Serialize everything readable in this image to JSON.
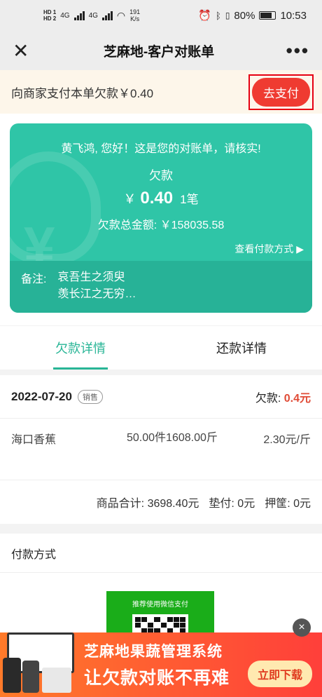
{
  "status_bar": {
    "hd1": "HD 1",
    "hd2": "HD 2",
    "net1": "4G",
    "net2": "4G",
    "speed_value": "191",
    "speed_unit": "K/s",
    "battery_percent": "80%",
    "battery_level": 0.8,
    "time": "10:53"
  },
  "nav": {
    "title": "芝麻地-客户对账单",
    "close_icon": "close-icon",
    "more_icon": "more-icon"
  },
  "pay_bar": {
    "text": "向商家支付本单欠款￥0.40",
    "button": "去支付"
  },
  "card": {
    "greeting": "黄飞鸿, 您好！这是您的对账单，请核实!",
    "debt_label": "欠款",
    "currency": "￥",
    "debt_value": "0.40",
    "debt_count": "1笔",
    "total_label": "欠款总金额: ￥158035.58",
    "payment_link": "查看付款方式",
    "remark_label": "备注:",
    "remark_line1": "哀吾生之须臾",
    "remark_line2": "羡长江之无穷…"
  },
  "tabs": [
    {
      "label": "欠款详情",
      "active": true
    },
    {
      "label": "还款详情",
      "active": false
    }
  ],
  "order": {
    "date": "2022-07-20",
    "tag": "销售",
    "debt_label": "欠款:",
    "debt_value": "0.4元",
    "items": [
      {
        "name": "海口香蕉",
        "qty": "50.00件1608.00斤",
        "price": "2.30元/斤"
      }
    ],
    "summary": {
      "goods_total": "商品合计: 3698.40元",
      "advance": "垫付: 0元",
      "deposit": "押筐: 0元"
    }
  },
  "payment": {
    "title": "付款方式",
    "qr_caption": "推荐使用微信支付"
  },
  "ad": {
    "line1": "芝麻地果蔬管理系统",
    "line2": "让欠款对账不再难",
    "button": "立即下载",
    "close": "×"
  },
  "colors": {
    "accent": "#2fc5a7",
    "pay_button": "#ef3b31",
    "debt_red": "#e04b36",
    "ad_orange": "#ff5a30"
  }
}
